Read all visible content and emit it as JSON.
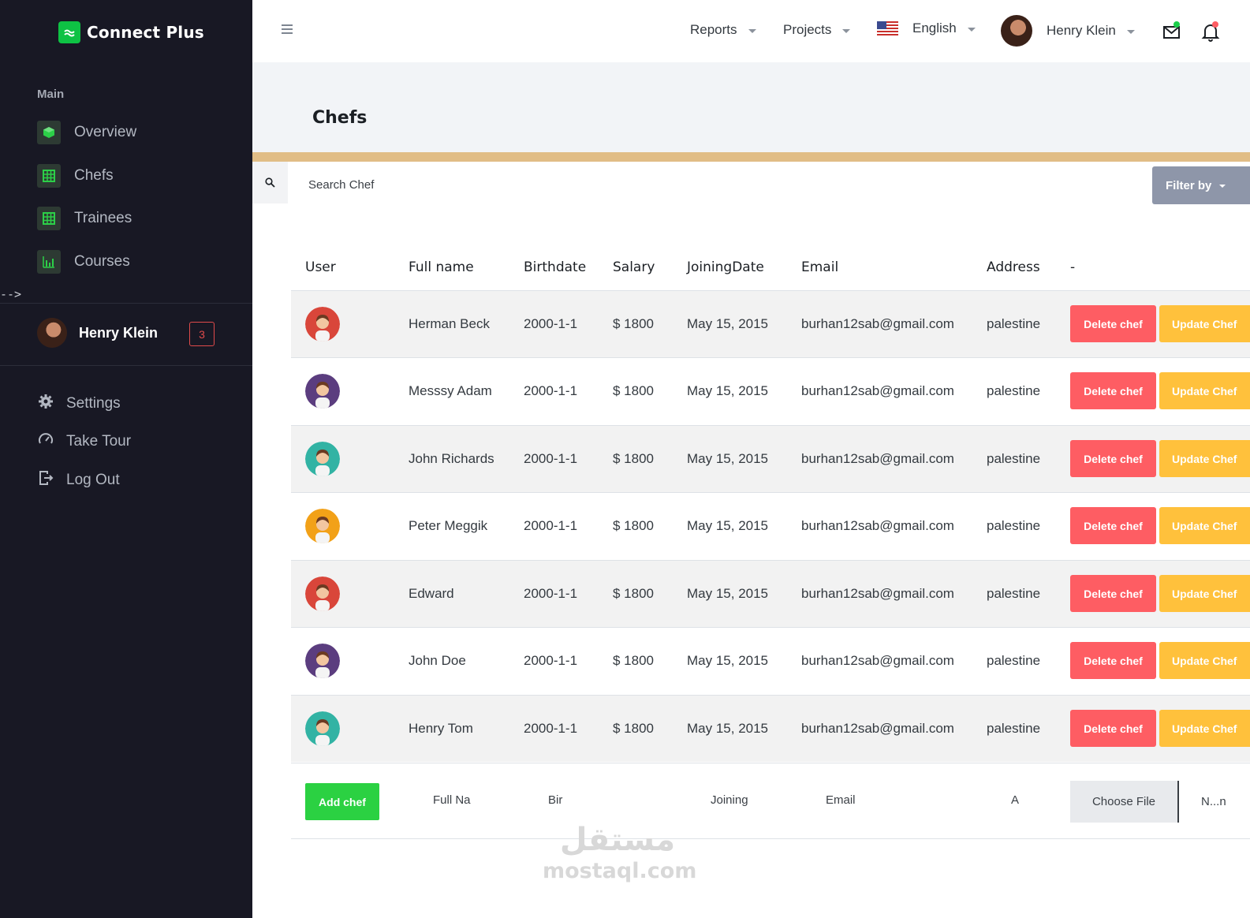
{
  "brand": {
    "name": "Connect Plus"
  },
  "sidebar": {
    "section_label": "Main",
    "items": [
      {
        "label": "Overview",
        "icon": "cube-icon"
      },
      {
        "label": "Chefs",
        "icon": "table-grid-icon"
      },
      {
        "label": "Trainees",
        "icon": "table-grid-icon"
      },
      {
        "label": "Courses",
        "icon": "bar-chart-icon"
      }
    ],
    "stray_text": "-->",
    "profile": {
      "name": "Henry Klein",
      "badge": "3"
    },
    "bottom": [
      {
        "label": "Settings",
        "icon": "gear-icon"
      },
      {
        "label": "Take Tour",
        "icon": "speedometer-icon"
      },
      {
        "label": "Log Out",
        "icon": "logout-icon"
      }
    ]
  },
  "topbar": {
    "reports": "Reports",
    "projects": "Projects",
    "language": "English",
    "user": "Henry Klein"
  },
  "page": {
    "title": "Chefs",
    "search_placeholder": "Search Chef",
    "filter_label": "Filter by"
  },
  "table": {
    "headers": [
      "User",
      "Full name",
      "Birthdate",
      "Salary",
      "JoiningDate",
      "Email",
      "Address",
      "-"
    ],
    "rows": [
      {
        "name": "Herman Beck",
        "birthdate": "2000-1-1",
        "salary": "$ 1800",
        "joining": "May 15, 2015",
        "email": "burhan12sab@gmail.com",
        "address": "palestine",
        "avatar_color": "#d9463a"
      },
      {
        "name": "Messsy Adam",
        "birthdate": "2000-1-1",
        "salary": "$ 1800",
        "joining": "May 15, 2015",
        "email": "burhan12sab@gmail.com",
        "address": "palestine",
        "avatar_color": "#5b3d7f"
      },
      {
        "name": "John Richards",
        "birthdate": "2000-1-1",
        "salary": "$ 1800",
        "joining": "May 15, 2015",
        "email": "burhan12sab@gmail.com",
        "address": "palestine",
        "avatar_color": "#32b3a4"
      },
      {
        "name": "Peter Meggik",
        "birthdate": "2000-1-1",
        "salary": "$ 1800",
        "joining": "May 15, 2015",
        "email": "burhan12sab@gmail.com",
        "address": "palestine",
        "avatar_color": "#f2a118"
      },
      {
        "name": "Edward",
        "birthdate": "2000-1-1",
        "salary": "$ 1800",
        "joining": "May 15, 2015",
        "email": "burhan12sab@gmail.com",
        "address": "palestine",
        "avatar_color": "#d9463a"
      },
      {
        "name": "John Doe",
        "birthdate": "2000-1-1",
        "salary": "$ 1800",
        "joining": "May 15, 2015",
        "email": "burhan12sab@gmail.com",
        "address": "palestine",
        "avatar_color": "#5b3d7f"
      },
      {
        "name": "Henry Tom",
        "birthdate": "2000-1-1",
        "salary": "$ 1800",
        "joining": "May 15, 2015",
        "email": "burhan12sab@gmail.com",
        "address": "palestine",
        "avatar_color": "#32b3a4"
      }
    ],
    "delete_label": "Delete chef",
    "update_label": "Update Chef"
  },
  "add_form": {
    "button": "Add chef",
    "fullname_placeholder": "Full Na",
    "birth_placeholder": "Bir",
    "joining_placeholder": "Joining",
    "email_placeholder": "Email",
    "address_placeholder": "A",
    "choose_file": "Choose File",
    "file_name": "N...n"
  },
  "watermark": {
    "arabic": "مستقل",
    "latin": "mostaql.com"
  },
  "colors": {
    "sidebar_bg": "#181824",
    "accent_bar": "#e1bd86",
    "delete": "#fe5d63",
    "update": "#ffc13c",
    "add": "#2bd142",
    "filter": "#8e96a9",
    "brand_green": "#0ec244"
  }
}
